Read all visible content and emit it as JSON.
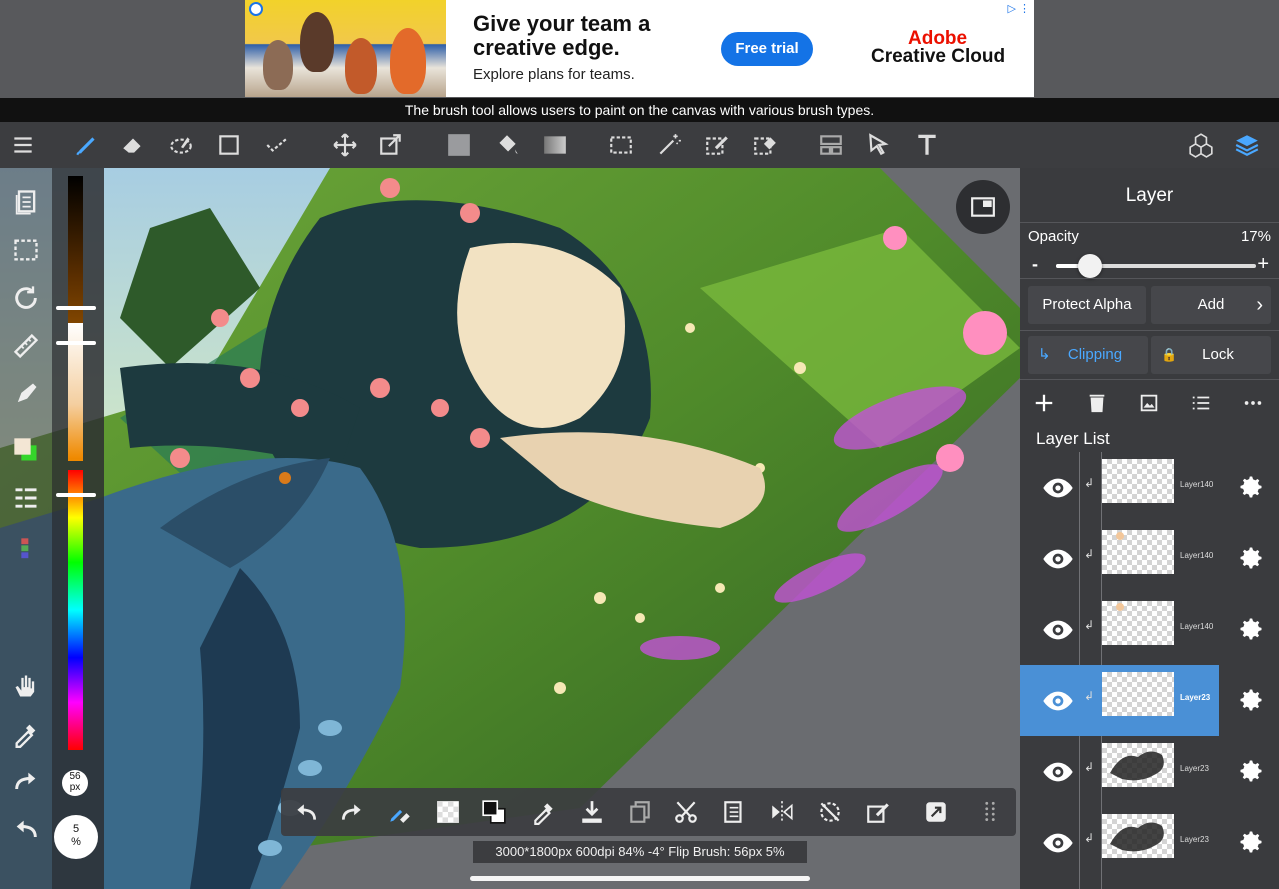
{
  "ad": {
    "headline": "Give your team a creative edge.",
    "subline": "Explore plans for teams.",
    "cta": "Free trial",
    "brand_line1": "Adobe",
    "brand_line2": "Creative Cloud",
    "brand_color": "#eb1000",
    "cta_color": "#1473e6"
  },
  "tooltip": "The brush tool allows users to paint on the canvas with various brush types.",
  "toolbar": {
    "tools": [
      "menu-icon",
      "brush-icon",
      "eraser-icon",
      "smudge-icon",
      "rectangle-icon",
      "select-check-icon",
      "move-icon",
      "transform-icon",
      "fill-color-icon",
      "bucket-icon",
      "gradient-icon",
      "marquee-icon",
      "magic-wand-icon",
      "pen-select-icon",
      "erase-select-icon",
      "layout-icon",
      "pointer-icon",
      "text-icon",
      "materials-icon",
      "layers-icon"
    ]
  },
  "left_strip": {
    "brush_size_value": "56",
    "brush_size_unit": "px",
    "opacity_value": "5",
    "opacity_unit": "%"
  },
  "bottom_bar": {
    "status": "3000*1800px 600dpi 84% -4° Flip Brush: 56px 5%"
  },
  "panel": {
    "title": "Layer",
    "opacity_label": "Opacity",
    "opacity_value": "17%",
    "opacity_fraction": 0.17,
    "minus": "-",
    "plus": "+",
    "protect_alpha": "Protect Alpha",
    "blend_mode": "Add",
    "clipping": "Clipping",
    "lock": "Lock",
    "layer_list_title": "Layer List",
    "layers": [
      {
        "name": "Layer140",
        "selected": false
      },
      {
        "name": "Layer140",
        "selected": false
      },
      {
        "name": "Layer140",
        "selected": false
      },
      {
        "name": "Layer23",
        "selected": true
      },
      {
        "name": "Layer23",
        "selected": false
      },
      {
        "name": "Layer23",
        "selected": false
      }
    ],
    "accent_color": "#4a90d6"
  }
}
